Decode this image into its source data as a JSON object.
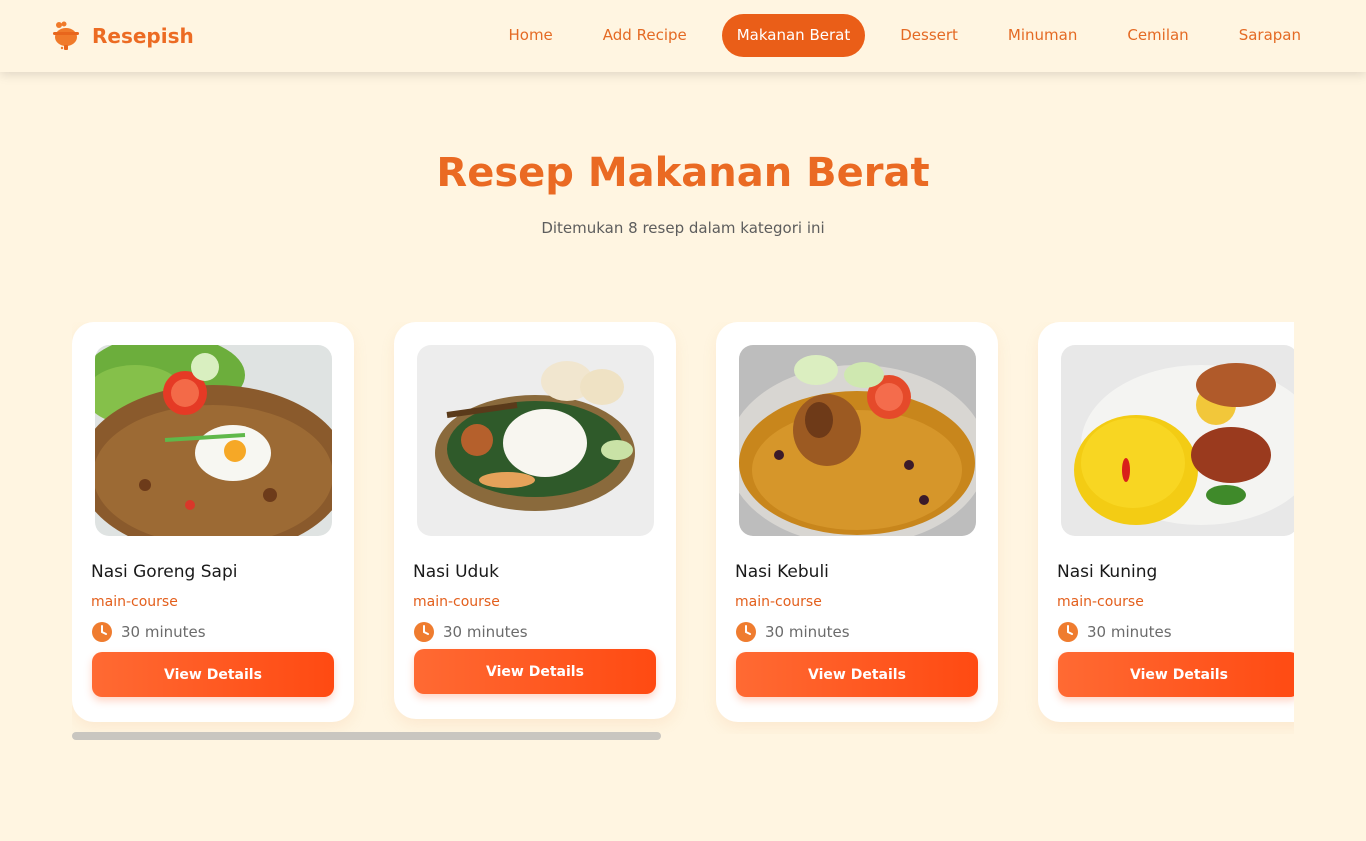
{
  "brand": {
    "name": "Resepish",
    "icon": "cooking-pot-icon",
    "color": "#ec6b23"
  },
  "nav": {
    "items": [
      {
        "label": "Home"
      },
      {
        "label": "Add Recipe"
      },
      {
        "label": "Makanan Berat",
        "active": true
      },
      {
        "label": "Dessert"
      },
      {
        "label": "Minuman"
      },
      {
        "label": "Cemilan"
      },
      {
        "label": "Sarapan"
      }
    ],
    "active_color": "#ea5e18"
  },
  "page": {
    "title": "Resep Makanan Berat",
    "subtitle": "Ditemukan 8 resep dalam kategori ini"
  },
  "recipes": [
    {
      "title": "Nasi Goreng Sapi",
      "category": "main-course",
      "time": "30 minutes",
      "button": "View Details"
    },
    {
      "title": "Nasi Uduk",
      "category": "main-course",
      "time": "30 minutes",
      "button": "View Details"
    },
    {
      "title": "Nasi Kebuli",
      "category": "main-course",
      "time": "30 minutes",
      "button": "View Details"
    },
    {
      "title": "Nasi Kuning",
      "category": "main-course",
      "time": "30 minutes",
      "button": "View Details"
    }
  ],
  "colors": {
    "background": "#fff5e1",
    "accent": "#ea6a23",
    "button_gradient_start": "#ff6a33",
    "button_gradient_end": "#ff4a12"
  }
}
